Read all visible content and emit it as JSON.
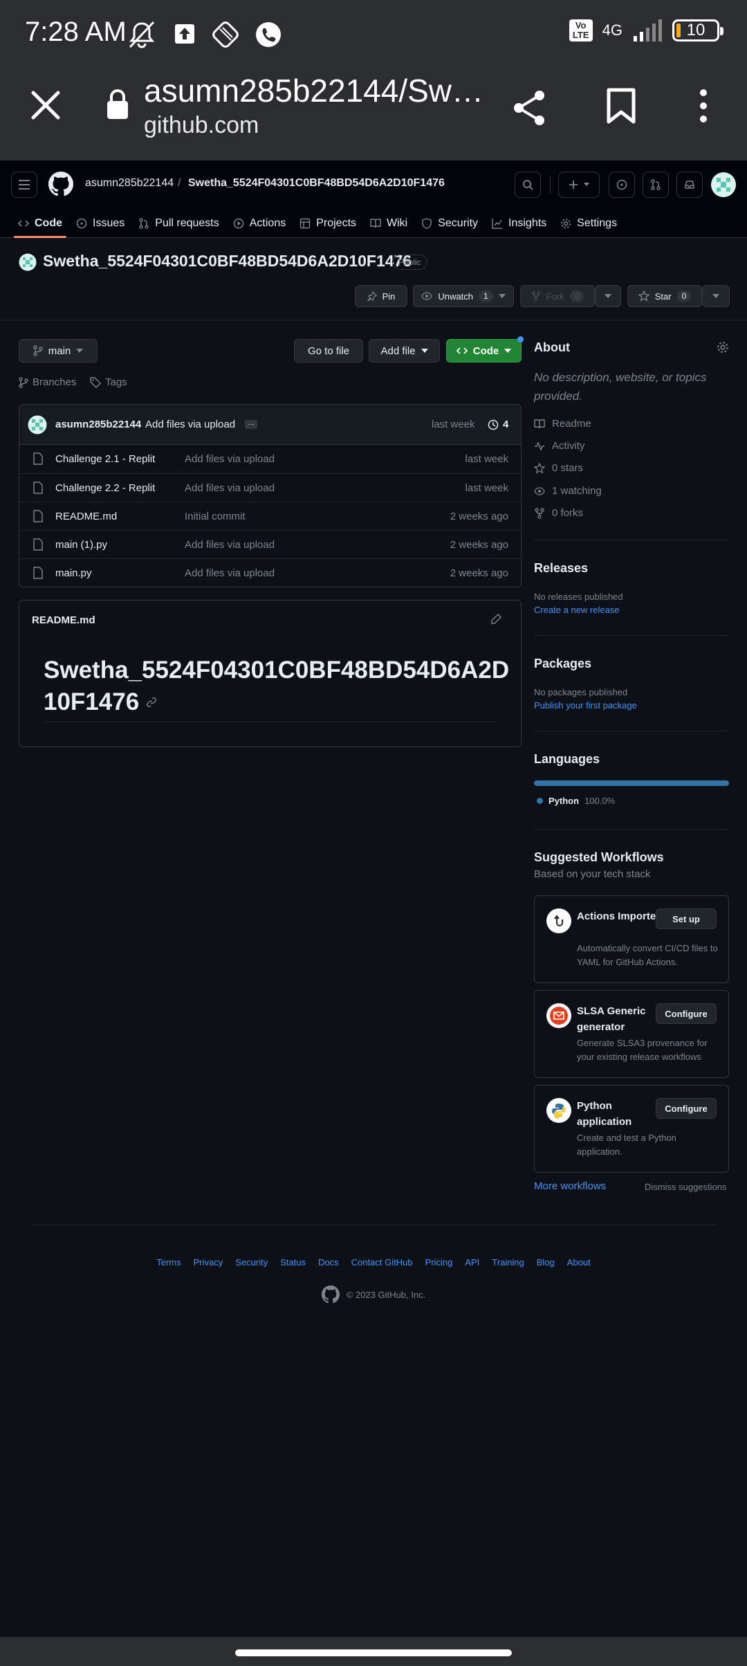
{
  "status_bar": {
    "time": "7:28 AM",
    "network": "4G",
    "volte": "Vo LTE",
    "battery": "10"
  },
  "browser": {
    "title": "asumn285b22144/Sw…",
    "host": "github.com"
  },
  "header": {
    "owner": "asumn285b22144",
    "separator": "/",
    "repo": "Swetha_5524F04301C0BF48BD54D6A2D10F1476"
  },
  "tabs": [
    {
      "label": "Code",
      "icon": "code-icon"
    },
    {
      "label": "Issues",
      "icon": "issue-icon"
    },
    {
      "label": "Pull requests",
      "icon": "pull-request-icon"
    },
    {
      "label": "Actions",
      "icon": "play-icon"
    },
    {
      "label": "Projects",
      "icon": "table-icon"
    },
    {
      "label": "Wiki",
      "icon": "book-icon"
    },
    {
      "label": "Security",
      "icon": "shield-icon"
    },
    {
      "label": "Insights",
      "icon": "graph-icon"
    },
    {
      "label": "Settings",
      "icon": "gear-icon"
    }
  ],
  "repo": {
    "title": "Swetha_5524F04301C0BF48BD54D6A2D10F1476",
    "visibility": "Public",
    "pin": "Pin",
    "unwatch": "Unwatch",
    "watch_count": "1",
    "fork": "Fork",
    "fork_count": "0",
    "star": "Star",
    "star_count": "0"
  },
  "toolbar": {
    "branch": "main",
    "go_to_file": "Go to file",
    "add_file": "Add file",
    "code": "Code",
    "branches": "Branches",
    "tags": "Tags"
  },
  "commit": {
    "author": "asumn285b22144",
    "message": "Add files via upload",
    "ellipsis": "···",
    "when": "last week",
    "count": "4"
  },
  "files": [
    {
      "name": "Challenge 2.1 - Replit",
      "message": "Add files via upload",
      "date": "last week"
    },
    {
      "name": "Challenge 2.2 - Replit",
      "message": "Add files via upload",
      "date": "last week"
    },
    {
      "name": "README.md",
      "message": "Initial commit",
      "date": "2 weeks ago"
    },
    {
      "name": "main (1).py",
      "message": "Add files via upload",
      "date": "2 weeks ago"
    },
    {
      "name": "main.py",
      "message": "Add files via upload",
      "date": "2 weeks ago"
    }
  ],
  "readme": {
    "filename": "README.md",
    "heading_line1": "Swetha_5524F04301C0BF48BD54D6A2D",
    "heading_line2": "10F1476"
  },
  "about": {
    "heading": "About",
    "description": "No description, website, or topics provided.",
    "items": [
      "Readme",
      "Activity",
      "0 stars",
      "1 watching",
      "0 forks"
    ]
  },
  "releases": {
    "heading": "Releases",
    "none": "No releases published",
    "create": "Create a new release"
  },
  "packages": {
    "heading": "Packages",
    "none": "No packages published",
    "publish": "Publish your first package"
  },
  "languages": {
    "heading": "Languages",
    "name": "Python",
    "percent": "100.0%",
    "color": "#3572A5"
  },
  "workflows": {
    "heading": "Suggested Workflows",
    "subheading": "Based on your tech stack",
    "cards": [
      {
        "title": "Actions Importer",
        "desc": "Automatically convert CI/CD files to YAML for GitHub Actions.",
        "button": "Set up"
      },
      {
        "title": "SLSA Generic generator",
        "desc": "Generate SLSA3 provenance for your existing release workflows",
        "button": "Configure"
      },
      {
        "title": "Python application",
        "desc": "Create and test a Python application.",
        "button": "Configure"
      }
    ],
    "more": "More workflows",
    "dismiss": "Dismiss suggestions"
  },
  "footer": {
    "links": [
      "Terms",
      "Privacy",
      "Security",
      "Status",
      "Docs",
      "Contact GitHub",
      "Pricing",
      "API",
      "Training",
      "Blog",
      "About"
    ],
    "copyright": "© 2023 GitHub, Inc."
  }
}
